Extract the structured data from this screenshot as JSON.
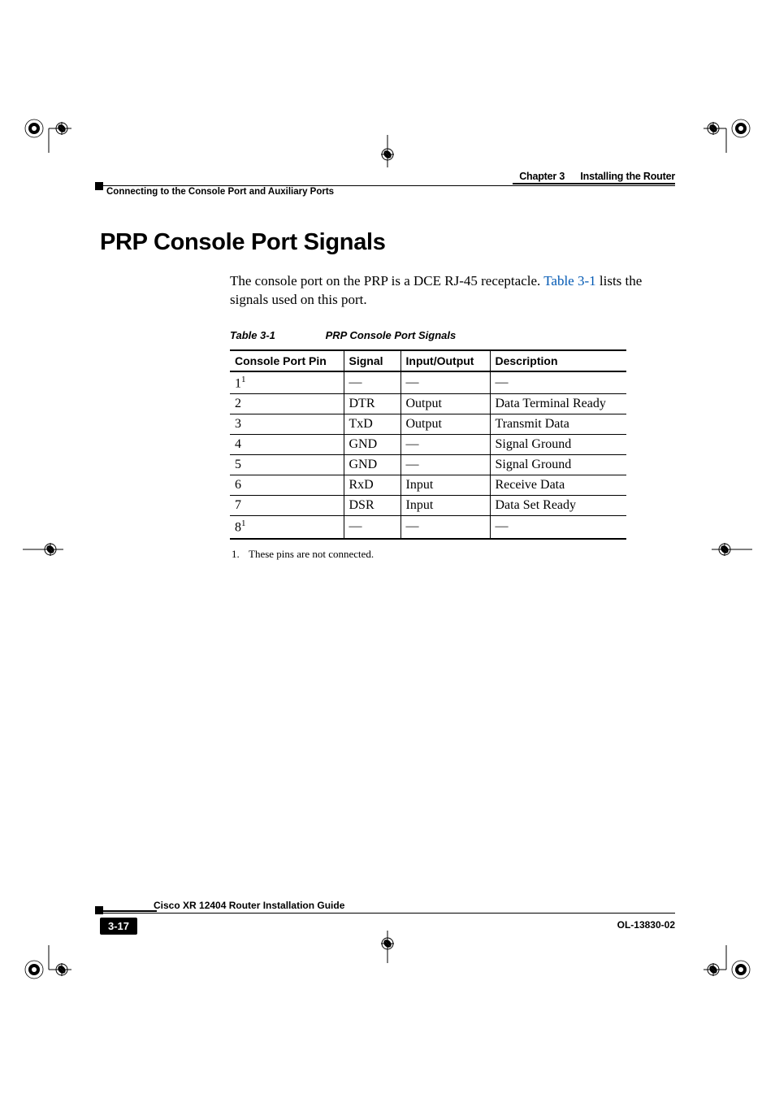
{
  "header": {
    "chapter_label": "Chapter 3",
    "chapter_title": "Installing the Router",
    "breadcrumb": "Connecting to the Console Port and Auxiliary Ports"
  },
  "section": {
    "heading": "PRP Console Port Signals",
    "body_before_xref": "The console port on the PRP is a DCE RJ-45 receptacle. ",
    "xref_text": "Table 3-1",
    "body_after_xref": " lists the signals used on this port."
  },
  "table": {
    "caption_label": "Table 3-1",
    "caption_title": "PRP Console Port Signals",
    "headers": {
      "c1": "Console Port Pin",
      "c2": "Signal",
      "c3": "Input/Output",
      "c4": "Description"
    },
    "rows": [
      {
        "pin": "1",
        "sup": "1",
        "signal": "—",
        "io": "—",
        "desc": "—"
      },
      {
        "pin": "2",
        "sup": "",
        "signal": "DTR",
        "io": "Output",
        "desc": "Data Terminal Ready"
      },
      {
        "pin": "3",
        "sup": "",
        "signal": "TxD",
        "io": "Output",
        "desc": "Transmit Data"
      },
      {
        "pin": "4",
        "sup": "",
        "signal": "GND",
        "io": "—",
        "desc": "Signal Ground"
      },
      {
        "pin": "5",
        "sup": "",
        "signal": "GND",
        "io": "—",
        "desc": "Signal Ground"
      },
      {
        "pin": "6",
        "sup": "",
        "signal": "RxD",
        "io": "Input",
        "desc": "Receive Data"
      },
      {
        "pin": "7",
        "sup": "",
        "signal": "DSR",
        "io": "Input",
        "desc": "Data Set Ready"
      },
      {
        "pin": "8",
        "sup": "1",
        "signal": "—",
        "io": "—",
        "desc": "—"
      }
    ],
    "footnote_num": "1.",
    "footnote_text": "These pins are not connected."
  },
  "footer": {
    "guide": "Cisco XR 12404 Router Installation Guide",
    "page": "3-17",
    "docid": "OL-13830-02"
  }
}
